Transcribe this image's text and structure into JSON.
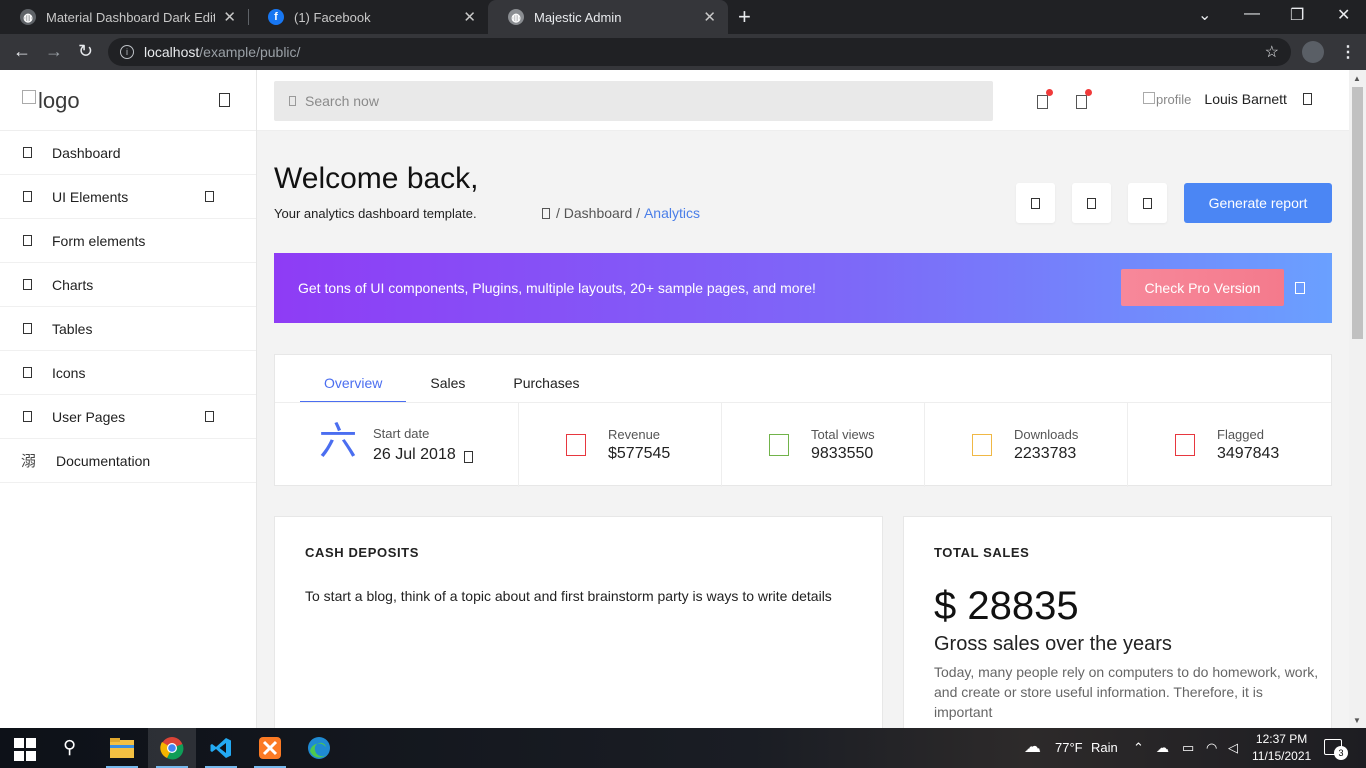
{
  "browser": {
    "tabs": [
      {
        "title": "Material Dashboard Dark Edition",
        "active": false
      },
      {
        "title": "(1) Facebook",
        "active": false
      },
      {
        "title": "Majestic Admin",
        "active": true
      }
    ],
    "url_host": "localhost",
    "url_path": "/example/public/"
  },
  "sidebar": {
    "logo_alt": "logo",
    "items": [
      {
        "label": "Dashboard",
        "has_arrow": false
      },
      {
        "label": "UI Elements",
        "has_arrow": true
      },
      {
        "label": "Form elements",
        "has_arrow": false
      },
      {
        "label": "Charts",
        "has_arrow": false
      },
      {
        "label": "Tables",
        "has_arrow": false
      },
      {
        "label": "Icons",
        "has_arrow": false
      },
      {
        "label": "User Pages",
        "has_arrow": true
      },
      {
        "label": "Documentation",
        "has_arrow": false,
        "glyph": "溺"
      }
    ]
  },
  "topnav": {
    "search_placeholder": "Search now",
    "profile_alt": "profile",
    "profile_name": "Louis Barnett"
  },
  "header": {
    "welcome": "Welcome back,",
    "subtitle": "Your analytics dashboard template.",
    "breadcrumb_sep1": "/",
    "breadcrumb_dashboard": "Dashboard",
    "breadcrumb_sep2": "/",
    "breadcrumb_active": "Analytics",
    "generate_label": "Generate report"
  },
  "promo": {
    "text": "Get tons of UI components, Plugins, multiple layouts, 20+ sample pages, and more!",
    "button_label": "Check Pro Version"
  },
  "stats": {
    "tabs": [
      "Overview",
      "Sales",
      "Purchases"
    ],
    "start_glyph": "六",
    "start_label": "Start date",
    "start_value": "26 Jul 2018",
    "items": [
      {
        "label": "Revenue",
        "value": "$577545",
        "color": "#e7373f"
      },
      {
        "label": "Total views",
        "value": "9833550",
        "color": "#71b34a"
      },
      {
        "label": "Downloads",
        "value": "2233783",
        "color": "#f0b845"
      },
      {
        "label": "Flagged",
        "value": "3497843",
        "color": "#e7373f"
      }
    ]
  },
  "cash_deposits": {
    "title": "CASH DEPOSITS",
    "text": "To start a blog, think of a topic about and first brainstorm party is ways to write details"
  },
  "total_sales": {
    "title": "TOTAL SALES",
    "amount": "$ 28835",
    "heading": "Gross sales over the years",
    "text": "Today, many people rely on computers to do homework, work, and create or store useful information. Therefore, it is important"
  },
  "taskbar": {
    "weather_temp": "77°F",
    "weather_text": "Rain",
    "time": "12:37 PM",
    "date": "11/15/2021",
    "notifications": "3"
  },
  "colors": {
    "accent": "#4b86f4",
    "tab_active": "#4b6ef0",
    "promo_start": "#8e3cf5",
    "promo_end": "#6aa0ff"
  }
}
